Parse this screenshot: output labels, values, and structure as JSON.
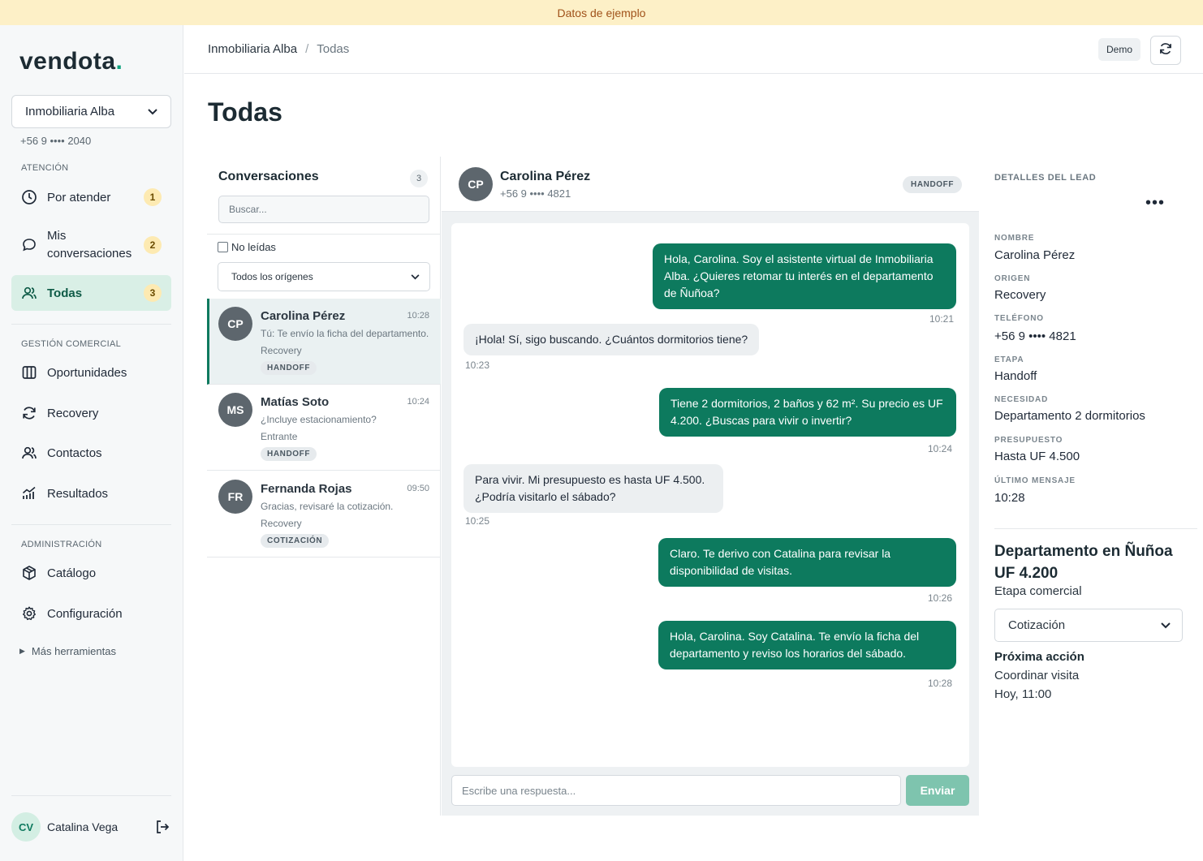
{
  "banner": {
    "text": "Datos de ejemplo"
  },
  "sidebar": {
    "logo": "vendota",
    "logo_dot": ".",
    "tenant": {
      "name": "Inmobiliaria Alba",
      "phone": "+56 9 •••• 2040"
    },
    "sections": {
      "attention": "ATENCIÓN",
      "commercial": "GESTIÓN COMERCIAL",
      "admin": "ADMINISTRACIÓN"
    },
    "items": {
      "pending": {
        "label": "Por atender",
        "badge": "1"
      },
      "mine": {
        "label_line1": "Mis",
        "label_line2": "conversaciones",
        "badge": "2"
      },
      "all": {
        "label": "Todas",
        "badge": "3"
      },
      "opportunities": {
        "label": "Oportunidades"
      },
      "recovery": {
        "label": "Recovery"
      },
      "contacts": {
        "label": "Contactos"
      },
      "results": {
        "label": "Resultados"
      },
      "catalog": {
        "label": "Catálogo"
      },
      "settings": {
        "label": "Configuración"
      }
    },
    "more_tools": "Más herramientas",
    "user": {
      "initials": "CV",
      "name": "Catalina Vega"
    }
  },
  "topbar": {
    "breadcrumb": [
      "Inmobiliaria Alba",
      "/",
      "Todas"
    ],
    "demo": "Demo"
  },
  "page": {
    "title": "Todas"
  },
  "conversations": {
    "header": "Conversaciones",
    "count": "3",
    "search_placeholder": "Buscar...",
    "unread_label": "No leídas",
    "origin_filter": "Todos los orígenes",
    "items": [
      {
        "initials": "CP",
        "name": "Carolina Pérez",
        "time": "10:28",
        "preview": "Tú: Te envío la ficha del departamento.",
        "origin": "Recovery",
        "tag": "HANDOFF"
      },
      {
        "initials": "MS",
        "name": "Matías Soto",
        "time": "10:24",
        "preview": "¿Incluye estacionamiento?",
        "origin": "Entrante",
        "tag": "HANDOFF"
      },
      {
        "initials": "FR",
        "name": "Fernanda Rojas",
        "time": "09:50",
        "preview": "Gracias, revisaré la cotización.",
        "origin": "Recovery",
        "tag": "COTIZACIÓN"
      }
    ]
  },
  "chat": {
    "initials": "CP",
    "name": "Carolina Pérez",
    "phone": "+56 9 •••• 4821",
    "tag": "HANDOFF",
    "messages": [
      {
        "dir": "out",
        "text": "Hola, Carolina. Soy el asistente virtual de Inmobiliaria Alba. ¿Quieres retomar tu interés en el departamento de Ñuñoa?",
        "time": "10:21"
      },
      {
        "dir": "in",
        "text": "¡Hola! Sí, sigo buscando. ¿Cuántos dormitorios tiene?",
        "time": "10:23"
      },
      {
        "dir": "out",
        "text": "Tiene 2 dormitorios, 2 baños y 62 m². Su precio es UF 4.200. ¿Buscas para vivir o invertir?",
        "time": "10:24"
      },
      {
        "dir": "in",
        "text": "Para vivir. Mi presupuesto es hasta UF 4.500. ¿Podría visitarlo el sábado?",
        "time": "10:25"
      },
      {
        "dir": "out",
        "text": "Claro. Te derivo con Catalina para revisar la disponibilidad de visitas.",
        "time": "10:26"
      },
      {
        "dir": "out",
        "text": "Hola, Carolina. Soy Catalina. Te envío la ficha del departamento y reviso los horarios del sábado.",
        "time": "10:28"
      }
    ],
    "composer_placeholder": "Escribe una respuesta...",
    "send_label": "Enviar"
  },
  "lead": {
    "title": "DETALLES DEL LEAD",
    "more": "•••",
    "fields": [
      {
        "label": "NOMBRE",
        "value": "Carolina Pérez"
      },
      {
        "label": "ORIGEN",
        "value": "Recovery"
      },
      {
        "label": "TELÉFONO",
        "value": "+56 9 •••• 4821"
      },
      {
        "label": "ETAPA",
        "value": "Handoff"
      },
      {
        "label": "NECESIDAD",
        "value": "Departamento 2 dormitorios"
      },
      {
        "label": "PRESUPUESTO",
        "value": "Hasta UF 4.500"
      },
      {
        "label": "ÚLTIMO MENSAJE",
        "value": "10:28"
      }
    ],
    "property": {
      "title_line1": "Departamento en Ñuñoa",
      "title_line2": "UF 4.200",
      "stage_label": "Etapa comercial",
      "stage_value": "Cotización"
    },
    "next_action": {
      "label": "Próxima acción",
      "value": "Coordinar visita",
      "time": "Hoy, 11:00"
    }
  },
  "colors": {
    "accent": "#0d7a5e",
    "banner_bg": "#fdf0c7",
    "badge_bg": "#fdeab2",
    "active_nav_bg": "#d9efe6"
  }
}
